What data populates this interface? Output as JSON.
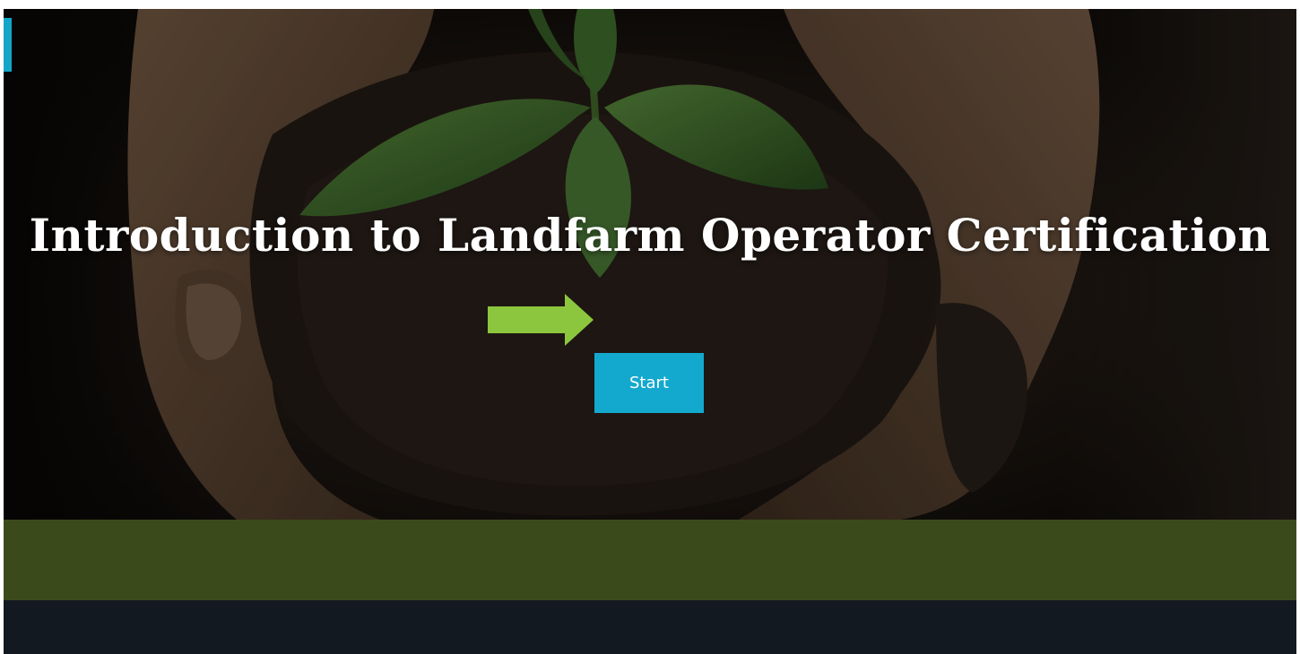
{
  "course": {
    "title": "Introduction to Landfarm Operator Certification",
    "start_label": "Start"
  },
  "colors": {
    "accent": "#13a9cf",
    "pointer_arrow": "#8cc63e",
    "green_band": "#3b4a1b",
    "footer": "#131921"
  },
  "icons": {
    "pointer": "arrow-right-icon",
    "hero": "seedling-in-soil-hands-image"
  }
}
